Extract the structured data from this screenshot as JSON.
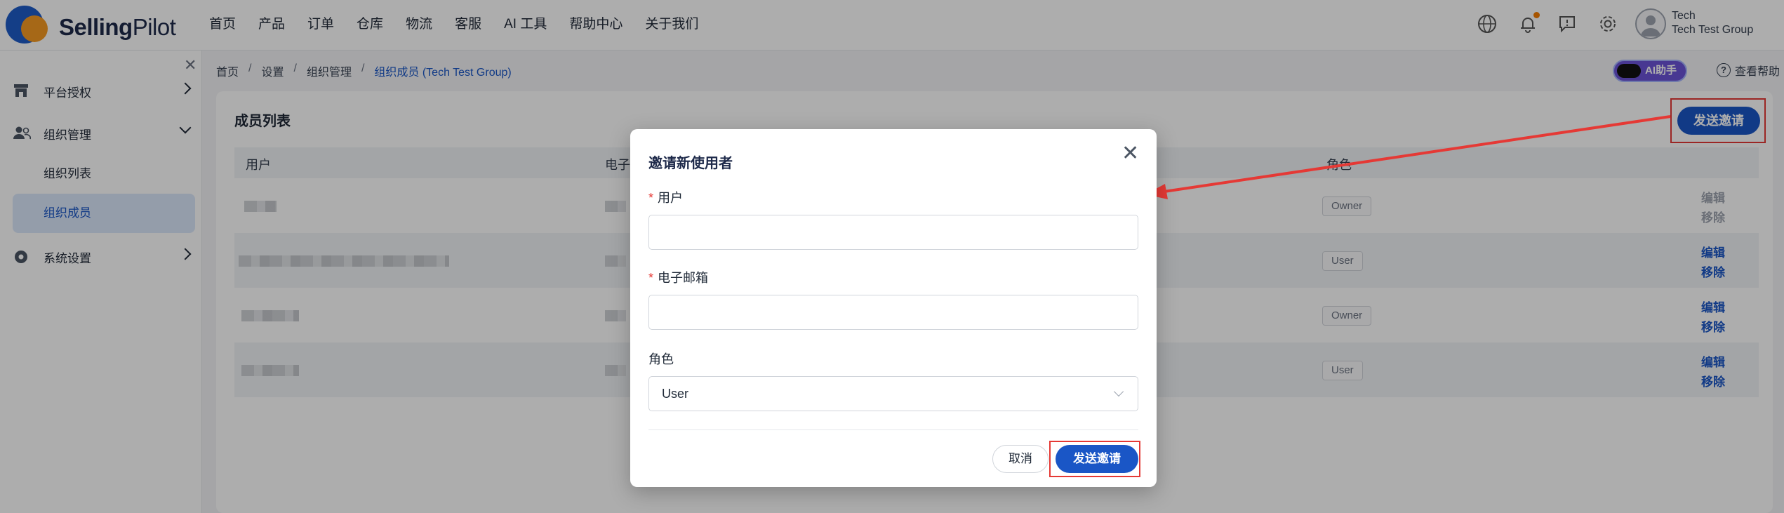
{
  "app": {
    "brand_bold": "Selling",
    "brand_thin": "Pilot"
  },
  "nav": {
    "items": [
      "首页",
      "产品",
      "订单",
      "仓库",
      "物流",
      "客服",
      "AI 工具",
      "帮助中心",
      "关于我们"
    ]
  },
  "topbar": {
    "icons": [
      "globe-icon",
      "bell-icon",
      "message-icon",
      "gear-icon"
    ],
    "user_name": "Tech",
    "user_group": "Tech Test Group"
  },
  "sidebar": {
    "items": [
      {
        "label": "平台授权",
        "icon": "store-icon"
      },
      {
        "label": "组织管理",
        "icon": "users-icon"
      },
      {
        "label": "系统设置",
        "icon": "gear-icon"
      }
    ],
    "sub_items": [
      "组织列表",
      "组织成员"
    ]
  },
  "breadcrumb": [
    "首页",
    "设置",
    "组织管理",
    "组织成员 (Tech Test Group)"
  ],
  "header_right": {
    "ai_label": "AI助手",
    "help_label": "查看帮助"
  },
  "card": {
    "title": "成员列表",
    "send_label": "发送邀请",
    "columns": [
      "用户",
      "电子",
      "角色"
    ],
    "rows": [
      {
        "role": "Owner",
        "edit": "编辑",
        "remove": "移除"
      },
      {
        "role": "User",
        "edit": "编辑",
        "remove": "移除"
      },
      {
        "role": "Owner",
        "edit": "编辑",
        "remove": "移除"
      },
      {
        "role": "User",
        "edit": "编辑",
        "remove": "移除"
      }
    ]
  },
  "modal": {
    "title": "邀请新使用者",
    "user_label": "用户",
    "email_label": "电子邮箱",
    "role_label": "角色",
    "role_value": "User",
    "user_value": "",
    "email_value": "",
    "cancel_label": "取消",
    "send_label": "发送邀请"
  },
  "colors": {
    "primary": "#1a56c6",
    "accent": "#f59a23",
    "annotation": "#e53935"
  }
}
